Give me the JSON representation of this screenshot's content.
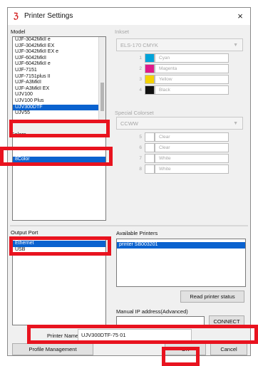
{
  "window": {
    "title": "Printer Settings",
    "close_glyph": "×",
    "app_icon_glyph": "ℨ"
  },
  "model": {
    "label": "Model",
    "items": [
      "UJF-3042MkII e",
      "UJF-3042MkII EX",
      "UJF-3042MkII EX e",
      "UJF-6042MkII",
      "UJF-6042MkII e",
      "UJF-7151",
      "UJF-7151plus II",
      "UJF-A3MkII",
      "UJF-A3MkII EX",
      "UJV100",
      "UJV100 Plus",
      "UJV300DTF",
      "UJV55"
    ],
    "selected": "UJV300DTF"
  },
  "colors": {
    "label": "Colors",
    "items": [
      "8Color"
    ],
    "selected": "8Color"
  },
  "inkset": {
    "label": "Inkset",
    "value": "ELS-170 CMYK",
    "inks": [
      {
        "num": "1",
        "name": "Cyan",
        "color": "#00a3d9"
      },
      {
        "num": "2",
        "name": "Magenta",
        "color": "#e0198a"
      },
      {
        "num": "3",
        "name": "Yellow",
        "color": "#f5d200"
      },
      {
        "num": "4",
        "name": "Black",
        "color": "#111111"
      }
    ]
  },
  "special_colorset": {
    "label": "Special Colorset",
    "value": "CCWW",
    "inks": [
      {
        "num": "5",
        "name": "Clear"
      },
      {
        "num": "6",
        "name": "Clear"
      },
      {
        "num": "7",
        "name": "White"
      },
      {
        "num": "8",
        "name": "White"
      }
    ]
  },
  "output_port": {
    "label": "Output Port",
    "items": [
      "Ethernet",
      "USB"
    ],
    "selected": "Ethernet"
  },
  "available_printers": {
    "label": "Available Printers",
    "items": [
      "printer SB003201"
    ]
  },
  "buttons": {
    "read_status": "Read printer status",
    "connect": "CONNECT",
    "profile": "Profile Management",
    "ok": "OK",
    "cancel": "Cancel"
  },
  "manual_ip": {
    "label": "Manual IP address(Advanced)",
    "value": ""
  },
  "printer_name": {
    "label": "Printer Name",
    "value": "UJV300DTF-75 01"
  },
  "accent": {
    "selection": "#0a62cf",
    "highlight": "#e8131f"
  }
}
